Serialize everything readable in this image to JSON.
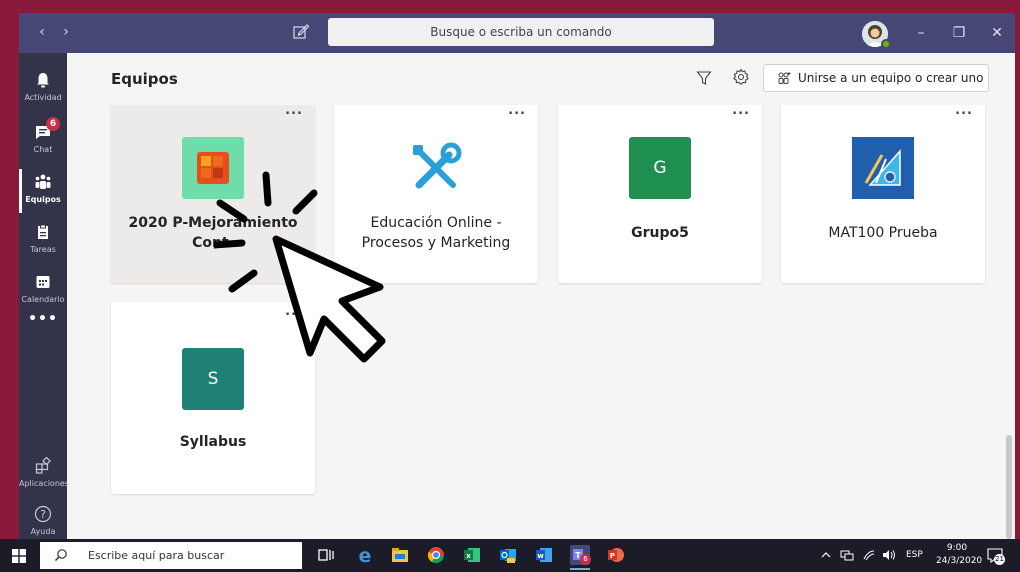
{
  "titlebar": {
    "search_placeholder": "Busque o escriba un comando",
    "back_label": "‹",
    "forward_label": "›",
    "minimize_label": "–",
    "maximize_label": "❐",
    "close_label": "✕"
  },
  "rail": {
    "items": [
      {
        "label": "Actividad",
        "icon": "bell-icon"
      },
      {
        "label": "Chat",
        "icon": "chat-icon",
        "badge": "6"
      },
      {
        "label": "Equipos",
        "icon": "teams-icon",
        "active": true
      },
      {
        "label": "Tareas",
        "icon": "assignments-icon"
      },
      {
        "label": "Calendario",
        "icon": "calendar-icon"
      }
    ],
    "more_label": "•••",
    "bottom": [
      {
        "label": "Aplicaciones",
        "icon": "apps-icon"
      },
      {
        "label": "Ayuda",
        "icon": "help-icon"
      }
    ]
  },
  "header": {
    "title": "Equipos",
    "join_label": "Unirse a un equipo o crear uno"
  },
  "cards": [
    {
      "line1": "2020 P-Mejoramiento",
      "line2": "Cont.",
      "bold": true,
      "tile": "orange-squares-logo",
      "color": "#6fdcab"
    },
    {
      "line1": "Educación Online -",
      "line2": "Procesos y Marketing",
      "bold": false,
      "tile": "tools-icon",
      "color": "#ffffff"
    },
    {
      "line1": "Grupo5",
      "line2": "",
      "bold": true,
      "tile_letter": "G",
      "color": "#1e8f4e"
    },
    {
      "line1": "MAT100 Prueba",
      "line2": "",
      "bold": false,
      "tile": "geometry-icon",
      "color": "#1f5fae"
    },
    {
      "line1": "Syllabus",
      "line2": "",
      "bold": true,
      "tile_letter": "S",
      "color": "#1f8076"
    }
  ],
  "card_menu_label": "...",
  "taskbar": {
    "search_placeholder": "Escribe aquí para buscar",
    "tray_lang": "ESP",
    "time": "9:00",
    "date": "24/3/2020",
    "notif_count": "21",
    "teams_badge": "6"
  },
  "colors": {
    "titlebar": "#464775",
    "rail": "#33344a",
    "frame": "#8a1a3c"
  }
}
